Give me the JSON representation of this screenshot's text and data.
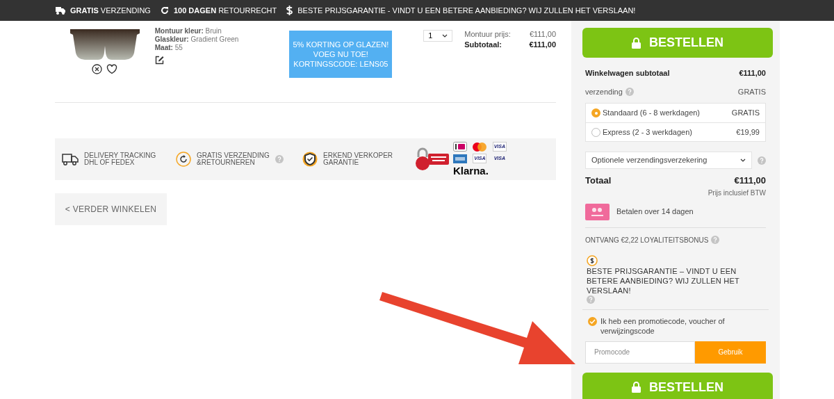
{
  "top_bar": [
    {
      "kind": "shipping",
      "text": "**GRATIS** VERZENDING"
    },
    {
      "kind": "returns",
      "text": "**100 DAGEN** RETOURRECHT"
    },
    {
      "kind": "price",
      "text": "BESTE PRIJSGARANTIE - VINDT U EEN BETERE AANBIEDING? WIJ ZULLEN HET VERSLAAN!"
    }
  ],
  "product": {
    "details": [
      {
        "label": "Montuur kleur:",
        "value": "Bruin"
      },
      {
        "label": "Glaskleur:",
        "value": "Gradient Green"
      },
      {
        "label": "Maat:",
        "value": "55"
      }
    ],
    "promo_banner": "5% KORTING OP GLAZEN! VOEG NU TOE! KORTINGSCODE: LENS05",
    "quantity": "1",
    "prices": [
      {
        "label": "Montuur prijs:",
        "value": "€111,00",
        "emphasis": false
      },
      {
        "label": "Subtotaal:",
        "value": "€111,00",
        "emphasis": true
      }
    ]
  },
  "features": [
    {
      "kind": "truck",
      "lines": [
        "DELIVERY TRACKING",
        "DHL OF FEDEX"
      ],
      "help": false
    },
    {
      "kind": "returns",
      "lines": [
        "GRATIS VERZENDING",
        "&RETOURNEREN"
      ],
      "help": true
    },
    {
      "kind": "shield",
      "lines": [
        "ERKEND VERKOPER",
        "GARANTIE"
      ],
      "help": false
    }
  ],
  "payment_logos": [
    {
      "kind": "comodo"
    },
    {
      "kind": "ideal"
    },
    {
      "kind": "mastercard"
    },
    {
      "kind": "visa",
      "text": "VISA"
    },
    {
      "kind": "amex"
    },
    {
      "kind": "visa",
      "text": "VISA"
    },
    {
      "kind": "visa_debit",
      "text": "VISA"
    },
    {
      "kind": "klarna",
      "text": "Klarna."
    }
  ],
  "continue_button": "< VERDER WINKELEN",
  "summary": {
    "order_button": "BESTELLEN",
    "subtotal": {
      "label": "Winkelwagen subtotaal",
      "value": "€111,00"
    },
    "shipping": {
      "label": "verzending",
      "value": "GRATIS"
    },
    "shipping_options": [
      {
        "label": "Standaard (6 - 8 werkdagen)",
        "price": "GRATIS",
        "selected": true
      },
      {
        "label": "Express (2 - 3 werkdagen)",
        "price": "€19,99",
        "selected": false
      }
    ],
    "insurance_select": "Optionele verzendingsverzekering",
    "total": {
      "label": "Totaal",
      "value": "€111,00",
      "note": "Prijs inclusief BTW"
    },
    "klarna_text": "Betalen over 14 dagen",
    "loyalty": "ONTVANG €2,22 LOYALITEITSBONUS",
    "guarantee": "BESTE PRIJSGARANTIE – VINDT U EEN BETERE AANBIEDING? WIJ ZULLEN HET VERSLAAN!",
    "promo_checkbox": {
      "label": "Ik heb een promotiecode, voucher of verwijzingscode",
      "checked": true
    },
    "promo_placeholder": "Promocode",
    "apply_button": "Gebruik",
    "order_button_bottom": "BESTELLEN"
  }
}
